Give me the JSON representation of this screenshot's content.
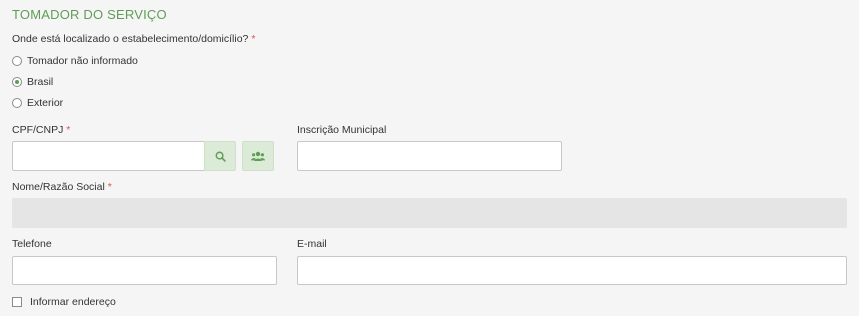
{
  "section": {
    "title": "TOMADOR DO SERVIÇO"
  },
  "location": {
    "question": "Onde está localizado o estabelecimento/domicílio?",
    "required_mark": "*",
    "options": [
      {
        "label": "Tomador não informado",
        "checked": false
      },
      {
        "label": "Brasil",
        "checked": true
      },
      {
        "label": "Exterior",
        "checked": false
      }
    ]
  },
  "fields": {
    "cpf_cnpj": {
      "label": "CPF/CNPJ",
      "required_mark": "*",
      "value": ""
    },
    "inscricao_municipal": {
      "label": "Inscrição Municipal",
      "value": ""
    },
    "nome_razao_social": {
      "label": "Nome/Razão Social",
      "required_mark": "*",
      "value": ""
    },
    "telefone": {
      "label": "Telefone",
      "value": ""
    },
    "email": {
      "label": "E-mail",
      "value": ""
    }
  },
  "buttons": {
    "search_icon": "search-icon",
    "users_icon": "users-icon"
  },
  "address_checkbox": {
    "label": "Informar endereço",
    "checked": false
  },
  "colors": {
    "accent": "#5f9d56",
    "required": "#d9534f",
    "button_bg": "#dcebd8",
    "disabled_bg": "#e5e5e5"
  }
}
